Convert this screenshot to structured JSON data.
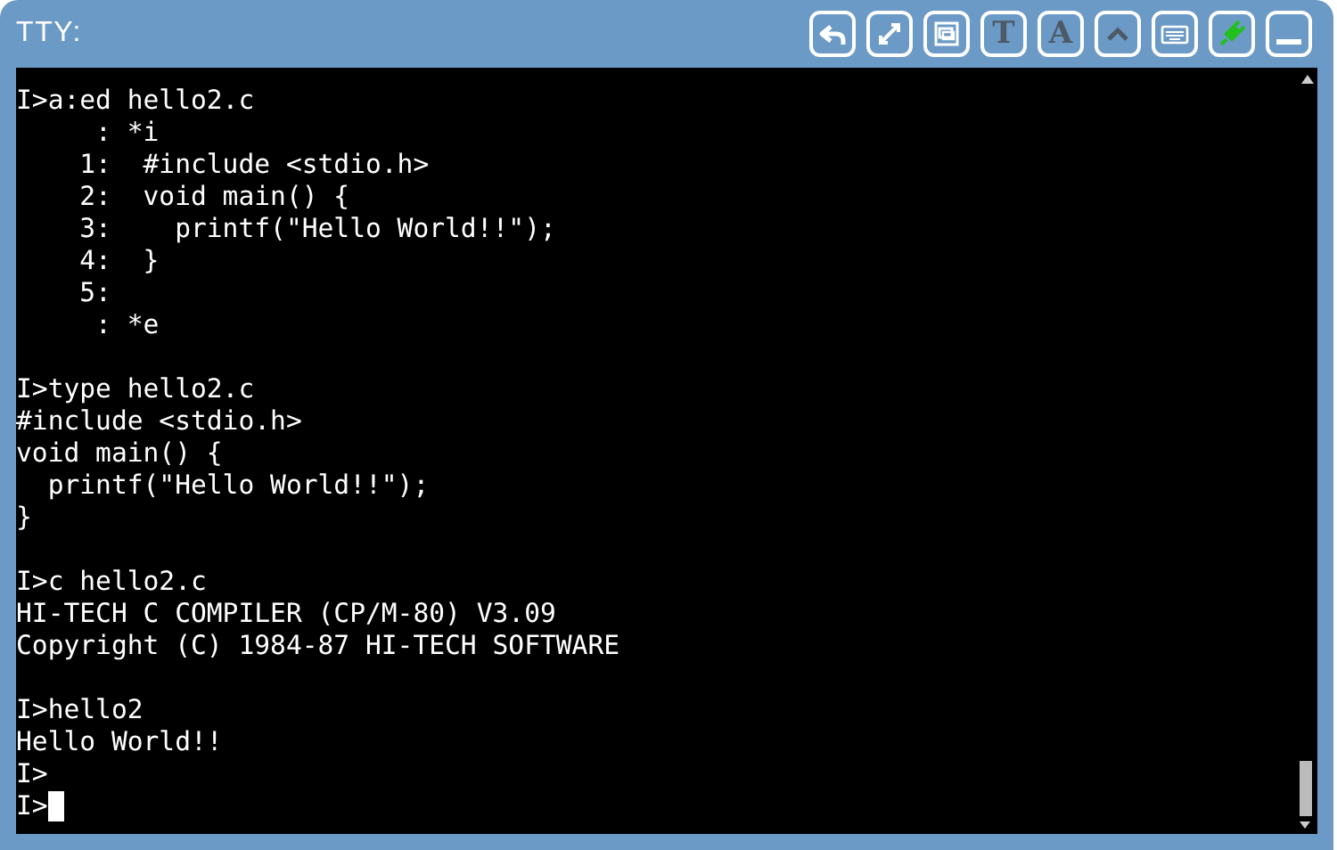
{
  "window": {
    "title": "TTY:"
  },
  "toolbar": [
    {
      "kind": "undo",
      "disabled": false
    },
    {
      "kind": "expand",
      "disabled": false
    },
    {
      "kind": "screen",
      "disabled": false
    },
    {
      "kind": "letter",
      "label": "T",
      "disabled": true
    },
    {
      "kind": "letter",
      "label": "A",
      "disabled": true
    },
    {
      "kind": "caret",
      "disabled": true
    },
    {
      "kind": "keyboard",
      "disabled": false
    },
    {
      "kind": "plug",
      "disabled": false,
      "on": true
    },
    {
      "kind": "minimize",
      "disabled": false
    }
  ],
  "terminal": {
    "lines": [
      "I>a:ed hello2.c",
      "     : *i",
      "    1:  #include <stdio.h>",
      "    2:  void main() {",
      "    3:    printf(\"Hello World!!\");",
      "    4:  }",
      "    5:",
      "     : *e",
      {
        "kind": "blank"
      },
      "I>type hello2.c",
      "#include <stdio.h>",
      "void main() {",
      "  printf(\"Hello World!!\");",
      "}",
      {
        "kind": "blank"
      },
      "I>c hello2.c",
      "HI-TECH C COMPILER (CP/M-80) V3.09",
      "Copyright (C) 1984-87 HI-TECH SOFTWARE",
      {
        "kind": "blank"
      },
      "I>hello2",
      "Hello World!!",
      "I>",
      "I>"
    ],
    "cursor": true
  }
}
